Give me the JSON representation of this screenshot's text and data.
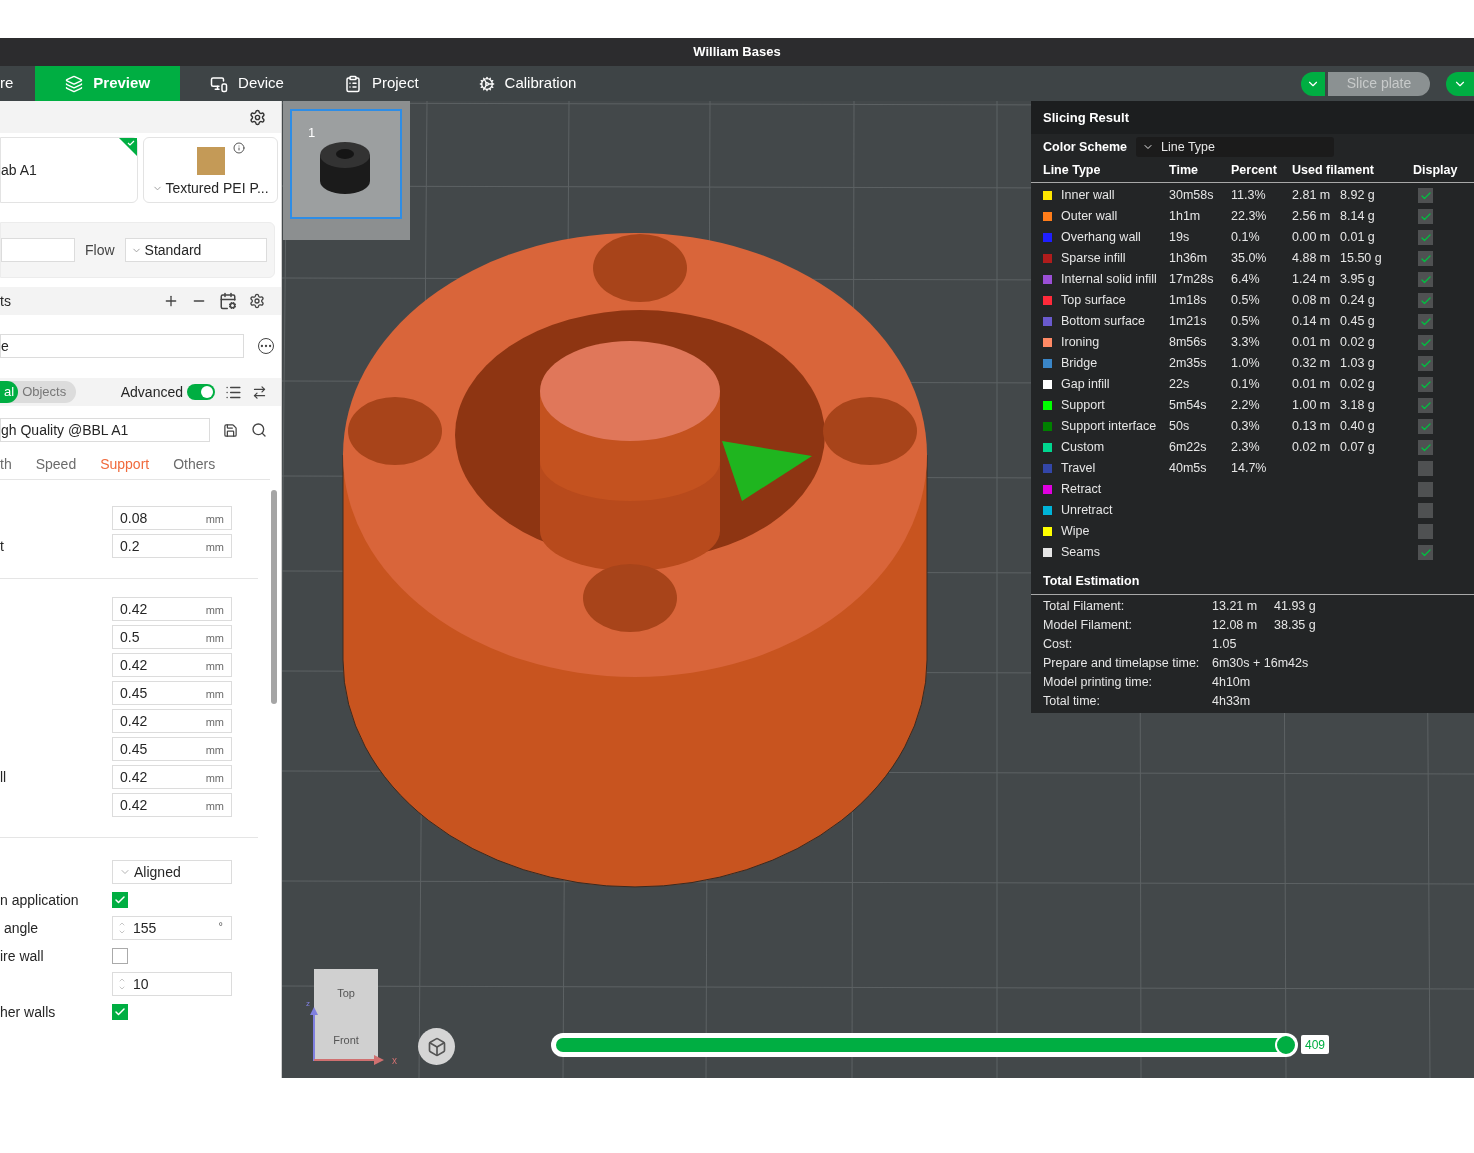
{
  "window": {
    "title": "William Bases"
  },
  "main_tabs": [
    {
      "label": "re",
      "selected": false
    },
    {
      "label": "Preview",
      "selected": true
    },
    {
      "label": "Device",
      "selected": false
    },
    {
      "label": "Project",
      "selected": false
    },
    {
      "label": "Calibration",
      "selected": false
    }
  ],
  "slice_button": {
    "label": "Slice plate",
    "disabled": true
  },
  "printer_card": {
    "name": "ab A1",
    "selected": true
  },
  "plate_card": {
    "name": "Textured PEI P..."
  },
  "filament_row": {
    "flow_label": "Flow",
    "flow_value": "Standard"
  },
  "objects_header": {
    "title": "ts"
  },
  "search_field": {
    "value": "e"
  },
  "segmented": [
    {
      "label": "al",
      "selected": true
    },
    {
      "label": "Objects",
      "selected": false
    }
  ],
  "advanced": {
    "label": "Advanced",
    "on": true
  },
  "preset": {
    "value": "gh Quality @BBL A1"
  },
  "setting_tabs": [
    {
      "label": "th",
      "selected": false
    },
    {
      "label": "Speed",
      "selected": false
    },
    {
      "label": "Support",
      "selected": true
    },
    {
      "label": "Others",
      "selected": false
    }
  ],
  "setting_groups": [
    {
      "rows": [
        {
          "kind": "number",
          "value": "0.08",
          "unit": "mm"
        },
        {
          "kind": "number",
          "label": "t",
          "value": "0.2",
          "unit": "mm"
        }
      ]
    },
    {
      "rows": [
        {
          "kind": "number",
          "value": "0.42",
          "unit": "mm"
        },
        {
          "kind": "number",
          "value": "0.5",
          "unit": "mm"
        },
        {
          "kind": "number",
          "value": "0.42",
          "unit": "mm"
        },
        {
          "kind": "number",
          "value": "0.45",
          "unit": "mm"
        },
        {
          "kind": "number",
          "value": "0.42",
          "unit": "mm"
        },
        {
          "kind": "number",
          "value": "0.45",
          "unit": "mm"
        },
        {
          "kind": "number",
          "label": "ll",
          "value": "0.42",
          "unit": "mm"
        },
        {
          "kind": "number",
          "value": "0.42",
          "unit": "mm"
        }
      ]
    },
    {
      "rows": [
        {
          "kind": "select",
          "value": "Aligned"
        },
        {
          "kind": "checkbox",
          "label": "n application",
          "checked": true
        },
        {
          "kind": "spin",
          "label": " angle",
          "value": "155",
          "unit": "°"
        },
        {
          "kind": "checkbox",
          "label": "ire wall",
          "checked": false
        },
        {
          "kind": "spin",
          "value": "10"
        },
        {
          "kind": "checkbox",
          "label": "her walls",
          "checked": true
        }
      ]
    }
  ],
  "plate_thumbnail": {
    "number": "1",
    "selected": true
  },
  "view_cube": {
    "top": "Top",
    "front": "Front",
    "x_axis": "x",
    "z_axis": "z"
  },
  "layer_slider": {
    "level": 1.0,
    "reading": "409"
  },
  "slicing_result": {
    "title": "Slicing Result",
    "color_scheme_label": "Color Scheme",
    "color_scheme_value": "Line Type",
    "columns": [
      "Line Type",
      "Time",
      "Percent",
      "Used filament",
      "Display"
    ],
    "rows": [
      {
        "name": "Inner wall",
        "color": "#ffe600",
        "time": "30m58s",
        "percent": "11.3%",
        "length": "2.81 m",
        "weight": "8.92 g",
        "display": true
      },
      {
        "name": "Outer wall",
        "color": "#ff7d1a",
        "time": "1h1m",
        "percent": "22.3%",
        "length": "2.56 m",
        "weight": "8.14 g",
        "display": true
      },
      {
        "name": "Overhang wall",
        "color": "#1f1fff",
        "time": "19s",
        "percent": "0.1%",
        "length": "0.00 m",
        "weight": "0.01 g",
        "display": true
      },
      {
        "name": "Sparse infill",
        "color": "#b01c1c",
        "time": "1h36m",
        "percent": "35.0%",
        "length": "4.88 m",
        "weight": "15.50 g",
        "display": true
      },
      {
        "name": "Internal solid infill",
        "color": "#9b4fd6",
        "time": "17m28s",
        "percent": "6.4%",
        "length": "1.24 m",
        "weight": "3.95 g",
        "display": true
      },
      {
        "name": "Top surface",
        "color": "#ff2a3a",
        "time": "1m18s",
        "percent": "0.5%",
        "length": "0.08 m",
        "weight": "0.24 g",
        "display": true
      },
      {
        "name": "Bottom surface",
        "color": "#6a5acd",
        "time": "1m21s",
        "percent": "0.5%",
        "length": "0.14 m",
        "weight": "0.45 g",
        "display": true
      },
      {
        "name": "Ironing",
        "color": "#ff8a65",
        "time": "8m56s",
        "percent": "3.3%",
        "length": "0.01 m",
        "weight": "0.02 g",
        "display": true
      },
      {
        "name": "Bridge",
        "color": "#3a86c8",
        "time": "2m35s",
        "percent": "1.0%",
        "length": "0.32 m",
        "weight": "1.03 g",
        "display": true
      },
      {
        "name": "Gap infill",
        "color": "#ffffff",
        "time": "22s",
        "percent": "0.1%",
        "length": "0.01 m",
        "weight": "0.02 g",
        "display": true
      },
      {
        "name": "Support",
        "color": "#00ff00",
        "time": "5m54s",
        "percent": "2.2%",
        "length": "1.00 m",
        "weight": "3.18 g",
        "display": true
      },
      {
        "name": "Support interface",
        "color": "#008000",
        "time": "50s",
        "percent": "0.3%",
        "length": "0.13 m",
        "weight": "0.40 g",
        "display": true
      },
      {
        "name": "Custom",
        "color": "#00d68f",
        "time": "6m22s",
        "percent": "2.3%",
        "length": "0.02 m",
        "weight": "0.07 g",
        "display": true
      },
      {
        "name": "Travel",
        "color": "#3346a8",
        "time": "40m5s",
        "percent": "14.7%",
        "display": false
      },
      {
        "name": "Retract",
        "color": "#e000e0",
        "display": false
      },
      {
        "name": "Unretract",
        "color": "#00b4d8",
        "display": false
      },
      {
        "name": "Wipe",
        "color": "#ffff00",
        "display": false
      },
      {
        "name": "Seams",
        "color": "#e6e6e6",
        "display": true
      }
    ],
    "total_title": "Total Estimation",
    "totals": [
      {
        "label": "Total Filament:",
        "value": "13.21 m",
        "value_2": "41.93 g"
      },
      {
        "label": "Model Filament:",
        "value": "12.08 m",
        "value_2": "38.35 g"
      },
      {
        "label": "Cost:",
        "value": "1.05"
      },
      {
        "label": "Prepare and timelapse time:",
        "value": "6m30s + 16m42s"
      },
      {
        "label": "Model printing time:",
        "value": "4h10m"
      },
      {
        "label": "Total time:",
        "value": "4h33m"
      }
    ]
  }
}
